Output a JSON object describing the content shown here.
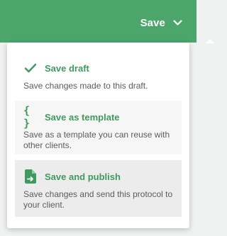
{
  "header": {
    "save_label": "Save",
    "chevron_icon": "chevron-down-icon",
    "background_color": "#4ca56a"
  },
  "menu": {
    "accent_color": "#3f9a5e",
    "items": [
      {
        "icon": "checkmark-icon",
        "title": "Save draft",
        "description": "Save changes made to this draft."
      },
      {
        "icon": "braces-icon",
        "icon_text": "{ }",
        "title": "Save as template",
        "description": "Save as a template you can reuse with other clients."
      },
      {
        "icon": "document-send-icon",
        "title": "Save and publish",
        "description": "Save changes and send this protocol to your client."
      }
    ]
  }
}
